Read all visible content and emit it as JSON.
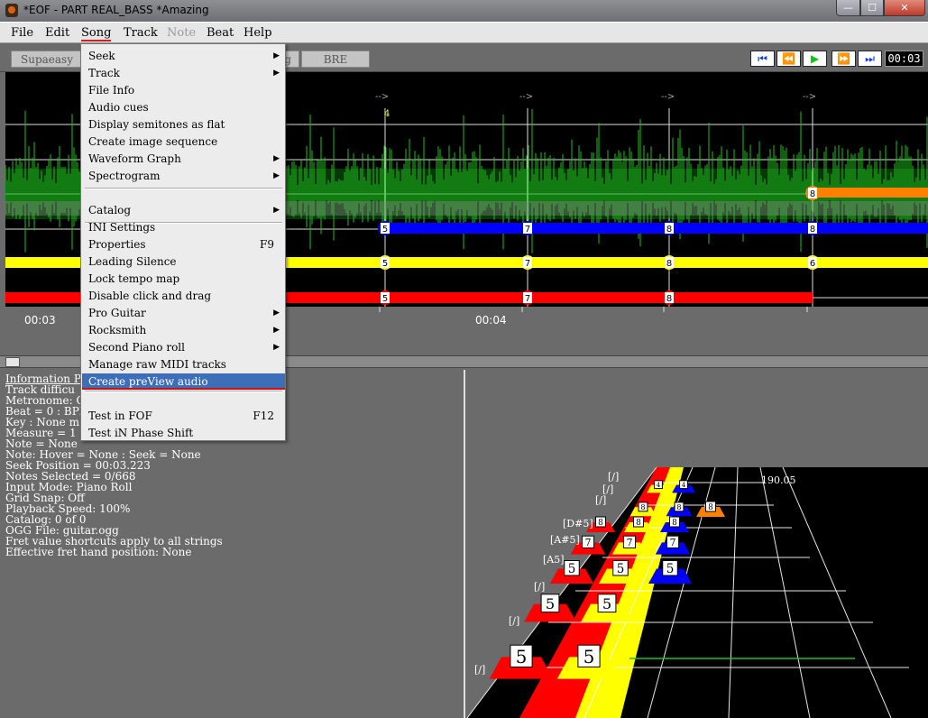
{
  "window": {
    "title": "*EOF - PART REAL_BASS  *Amazing",
    "min": "—",
    "max": "☐",
    "close": "✕"
  },
  "menubar": [
    "File",
    "Edit",
    "Song",
    "Track",
    "Note",
    "Beat",
    "Help"
  ],
  "toolbar": {
    "tab1": "Supaeasy",
    "tab2": "g",
    "tab3": "BRE",
    "time": "00:03",
    "buttons": [
      "⏮",
      "⏪",
      "▶",
      "⏩",
      "⏭"
    ]
  },
  "timeline": {
    "t1": "00:03",
    "t2": "00:04",
    "marker": "4"
  },
  "song_menu": {
    "items": [
      {
        "label": "Seek",
        "sub": true
      },
      {
        "label": "Track",
        "sub": true
      },
      {
        "label": "File Info"
      },
      {
        "label": "Audio cues"
      },
      {
        "label": "Display semitones as flat"
      },
      {
        "label": "Create image sequence"
      },
      {
        "label": "Waveform Graph",
        "sub": true
      },
      {
        "label": "Spectrogram",
        "sub": true
      },
      {
        "label": "Catalog",
        "sub": true
      },
      {
        "label": "INI Settings"
      },
      {
        "label": "Properties",
        "shortcut": "F9"
      },
      {
        "label": "Leading Silence"
      },
      {
        "label": "Lock tempo map"
      },
      {
        "label": "Disable click and drag"
      },
      {
        "label": "Pro Guitar",
        "sub": true
      },
      {
        "label": "Rocksmith",
        "sub": true
      },
      {
        "label": "Second Piano roll",
        "sub": true
      },
      {
        "label": "Manage raw MIDI tracks"
      },
      {
        "label": "Create preView audio",
        "highlight": true
      },
      {
        "label": "Test in FOF",
        "shortcut": "F12"
      },
      {
        "label": "Test iN Phase Shift"
      }
    ]
  },
  "info": {
    "heading": "Information P",
    "lines": [
      "Track difficu",
      "Metronome: O",
      "Beat = 0 : BPI",
      "Key : None m",
      "Measure = 1 (",
      "Note = None",
      "Note: Hover = None : Seek = None",
      "Seek Position = 00:03.223",
      "Notes Selected = 0/668",
      "Input Mode: Piano Roll",
      "Grid Snap: Off",
      "Playback Speed: 100%",
      "Catalog: 0 of 0",
      "OGG File: guitar.ogg",
      "Fret value shortcuts apply to all strings",
      "Effective fret hand position:  None"
    ]
  },
  "highway": {
    "tempo": "190.05",
    "labels": [
      "[/]",
      "[/]",
      "[/]",
      "[D#5]",
      "[A#5]",
      "[A5]",
      "[/]",
      "[/]",
      "[/]"
    ]
  },
  "colors": {
    "red": "#ff0000",
    "yellow": "#ffff00",
    "blue": "#0000ff",
    "orange": "#ff8000",
    "green": "#18a018",
    "menu_hl": "#3c6fb8"
  }
}
